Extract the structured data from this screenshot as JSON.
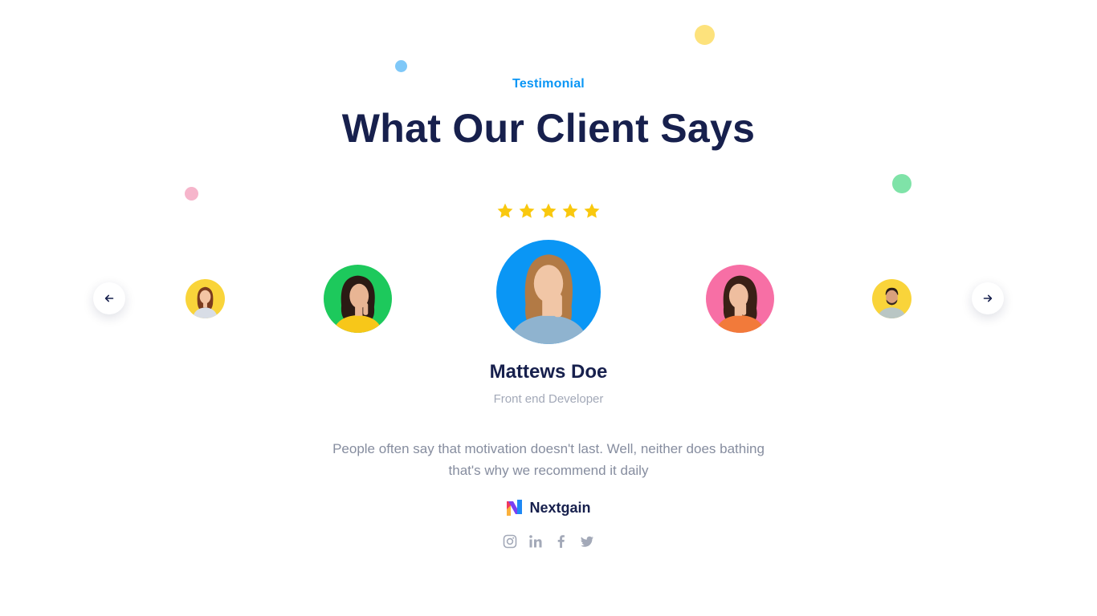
{
  "section": {
    "eyebrow": "Testimonial",
    "headline": "What Our Client Says"
  },
  "rating": {
    "stars": 5,
    "max": 5,
    "color": "#f9c80e"
  },
  "carousel": {
    "prev_icon": "arrow-left-icon",
    "next_icon": "arrow-right-icon",
    "avatars": [
      {
        "slot": "far-left",
        "background": "#f9d43a"
      },
      {
        "slot": "near-left",
        "background": "#1dc95c"
      },
      {
        "slot": "active",
        "background": "#0a96f5"
      },
      {
        "slot": "near-right",
        "background": "#f76fa5"
      },
      {
        "slot": "far-right",
        "background": "#f9d43a"
      }
    ]
  },
  "active_testimonial": {
    "name": "Mattews Doe",
    "role": "Front end Developer",
    "quote": "People often say that motivation doesn't last. Well, neither does bathing that's why we recommend it daily",
    "company": "Nextgain"
  },
  "socials": [
    {
      "icon": "instagram-icon"
    },
    {
      "icon": "linkedin-icon"
    },
    {
      "icon": "facebook-icon"
    },
    {
      "icon": "twitter-icon"
    }
  ],
  "colors": {
    "accent": "#0a96f5",
    "heading": "#17204d",
    "muted": "#a3a9b8",
    "dot_yellow": "#fde27c",
    "dot_blue": "#7fc8f8",
    "dot_pink": "#f6b5cb",
    "dot_green": "#7fe3a8"
  }
}
